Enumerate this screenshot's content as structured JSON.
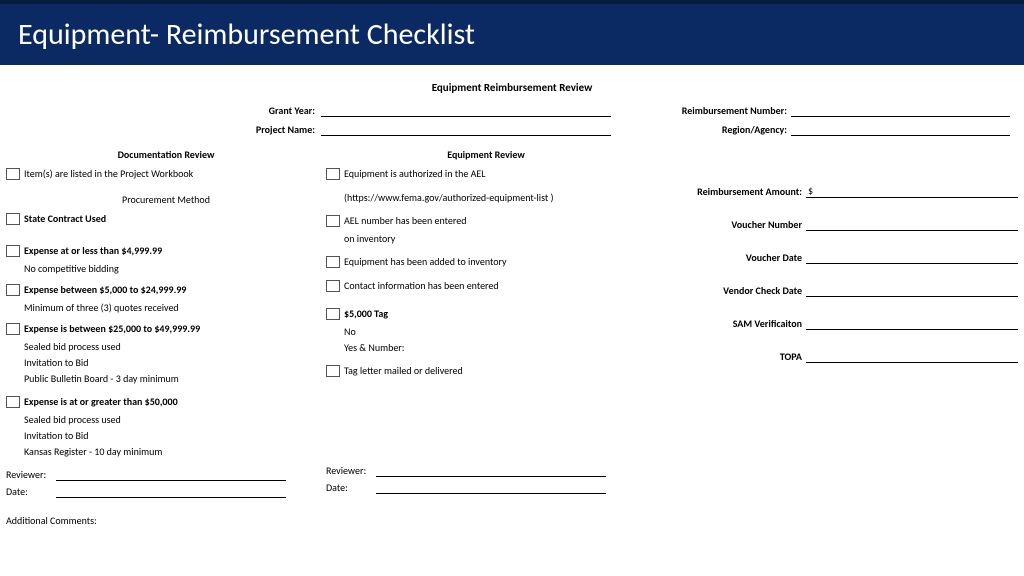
{
  "banner": {
    "title": "Equipment- Reimbursement Checklist"
  },
  "doc_title": "Equipment Reimbursement Review",
  "top": {
    "grant_year_label": "Grant Year:",
    "project_name_label": "Project Name:",
    "reimb_num_label": "Reimbursement Number:",
    "region_agency_label": "Region/Agency:"
  },
  "left": {
    "heading": "Documentation Review",
    "item_listed": "Item(s) are listed in the Project Workbook",
    "procurement_head": "Procurement Method",
    "state_contract": "State Contract Used",
    "t1_title": "Expense at or less than $4,999.99",
    "t1_sub": "No competitive bidding",
    "t2_title": "Expense between $5,000 to $24,999.99",
    "t2_sub": "Minimum of three (3) quotes received",
    "t3_title": "Expense is between $25,000 to $49,999.99",
    "t3_sub1": "Sealed bid process used",
    "t3_sub2": "Invitation to Bid",
    "t3_sub3": "Public Bulletin Board - 3 day minimum",
    "t4_title": "Expense is at or greater than $50,000",
    "t4_sub1": "Sealed bid process used",
    "t4_sub2": "Invitation to Bid",
    "t4_sub3": "Kansas Register - 10 day minimum",
    "reviewer_label": "Reviewer:",
    "date_label": "Date:",
    "additional": "Additional Comments:"
  },
  "mid": {
    "heading": "Equipment Review",
    "ael_auth": "Equipment is authorized in the AEL",
    "ael_url": "(https://www.fema.gov/authorized-equipment-list )",
    "ael_entered": "AEL number has been entered",
    "on_inv": "on inventory",
    "added_inv": "Equipment has been added to inventory",
    "contact": "Contact information has been entered",
    "tag_title": "$5,000 Tag",
    "tag_no": "No",
    "tag_yes": "Yes & Number:",
    "tag_letter": "Tag letter mailed or delivered",
    "reviewer_label": "Reviewer:",
    "date_label": "Date:"
  },
  "right": {
    "reimb_amount": "Reimbursement Amount:",
    "dollar": "$",
    "voucher_num": "Voucher Number",
    "voucher_date": "Voucher Date",
    "vendor_check": "Vendor Check Date",
    "sam": "SAM Verificaiton",
    "topa": "TOPA"
  }
}
